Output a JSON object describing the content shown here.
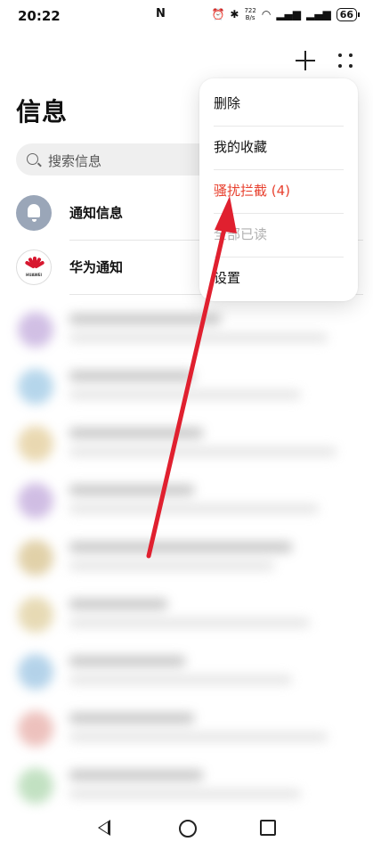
{
  "status_bar": {
    "time": "20:22",
    "nfc": "N",
    "net_speed_top": "722",
    "net_speed_bottom": "B/s",
    "battery": "66"
  },
  "header": {
    "title": "信息",
    "add_icon": "plus-icon",
    "more_icon": "more-dots-icon"
  },
  "search": {
    "placeholder": "搜索信息"
  },
  "conversations": [
    {
      "name": "通知信息",
      "icon": "bell-icon"
    },
    {
      "name": "华为通知",
      "icon": "huawei-logo",
      "logo_text": "HUAWEI"
    }
  ],
  "menu": {
    "items": [
      {
        "label": "删除"
      },
      {
        "label": "我的收藏"
      },
      {
        "label": "骚扰拦截 (4)",
        "color": "#e8412f"
      },
      {
        "label": "全部已读",
        "state": "disabled"
      },
      {
        "label": "设置"
      }
    ]
  },
  "annotation": {
    "arrow_color": "#e0202f"
  },
  "nav_bar": {
    "back": "back-icon",
    "home": "home-icon",
    "recents": "recents-icon"
  }
}
